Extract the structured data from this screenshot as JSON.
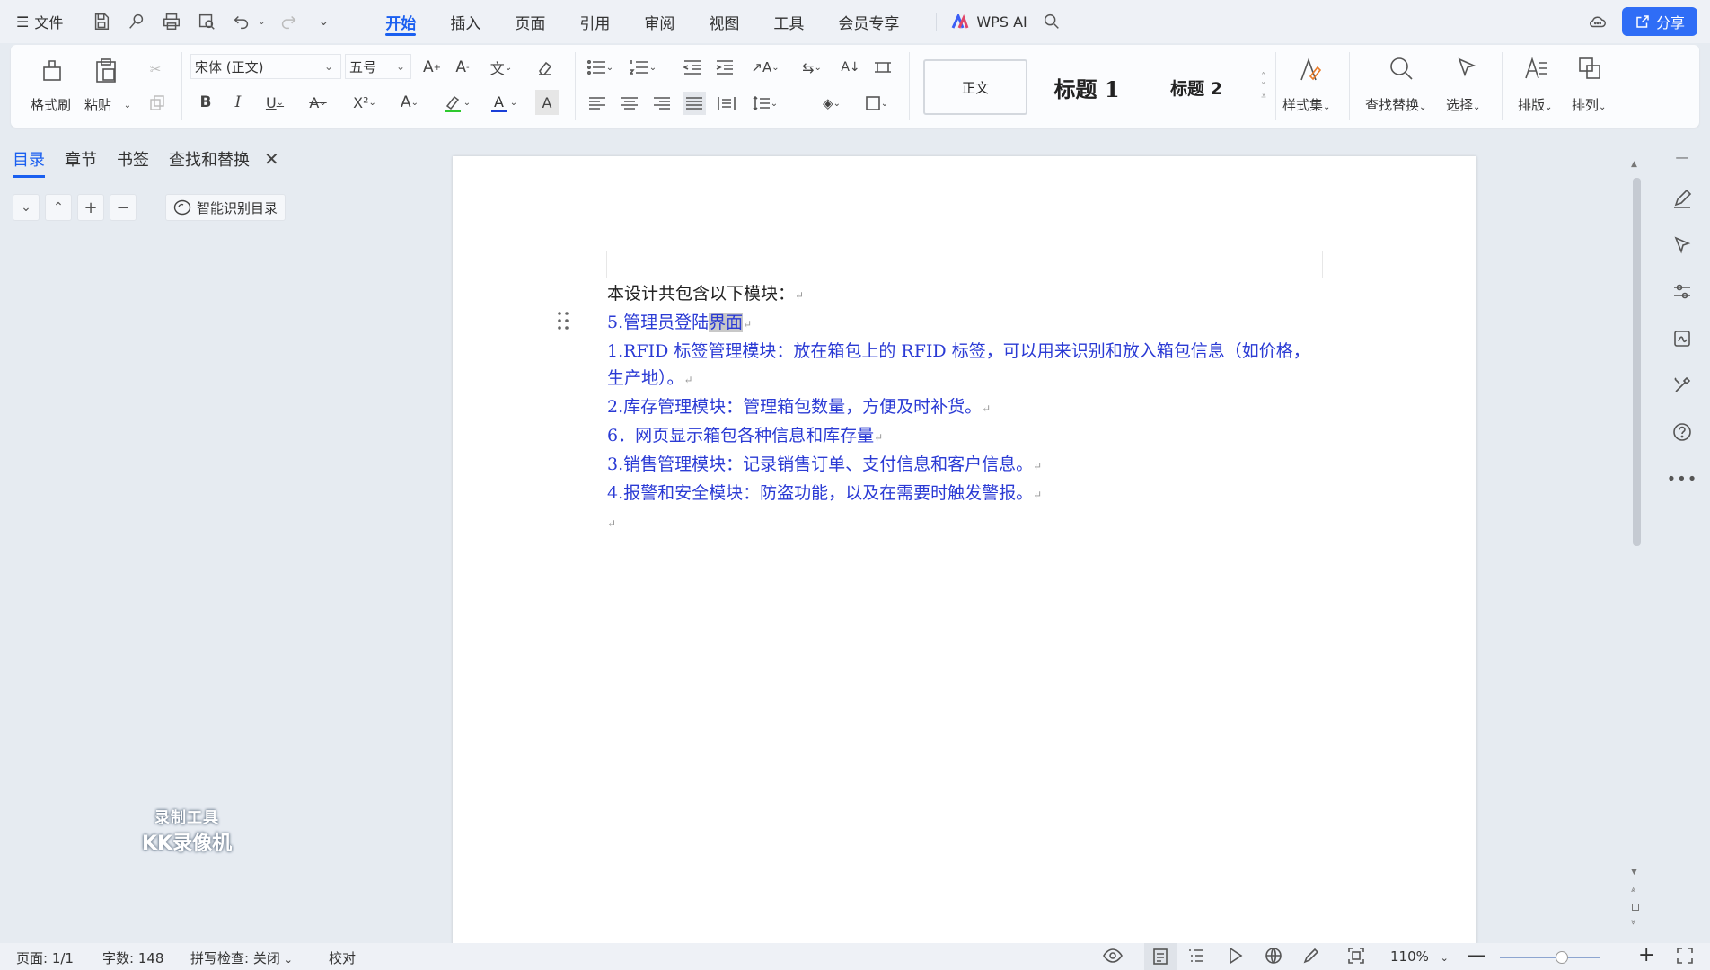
{
  "menubar": {
    "file_label": "文件",
    "tabs": [
      "开始",
      "插入",
      "页面",
      "引用",
      "审阅",
      "视图",
      "工具",
      "会员专享"
    ],
    "active_tab": "开始",
    "ai_label": "WPS AI",
    "share_label": "分享"
  },
  "ribbon": {
    "format_painter": "格式刷",
    "paste": "粘贴",
    "font_name": "宋体 (正文)",
    "font_size": "五号",
    "styles": [
      "正文",
      "标题 1",
      "标题 2"
    ],
    "style_set": "样式集",
    "find_replace": "查找替换",
    "select": "选择",
    "layout": "排版",
    "arrange": "排列"
  },
  "nav": {
    "tabs": [
      "目录",
      "章节",
      "书签",
      "查找和替换"
    ],
    "active_tab": "目录",
    "smart_toc": "智能识别目录"
  },
  "document": {
    "lines": [
      {
        "text": "本设计共包含以下模块：",
        "color": "black"
      },
      {
        "text_pre": "5.管理员登陆",
        "text_hl": "界面",
        "color": "blue"
      },
      {
        "text": "1.RFID 标签管理模块：放在箱包上的 RFID 标签，可以用来识别和放入箱包信息（如价格，",
        "color": "blue"
      },
      {
        "text": "生产地）。",
        "color": "blue"
      },
      {
        "text": "2.库存管理模块：管理箱包数量，方便及时补货。",
        "color": "blue"
      },
      {
        "text": "6．网页显示箱包各种信息和库存量",
        "color": "blue"
      },
      {
        "text": "3.销售管理模块：记录销售订单、支付信息和客户信息。",
        "color": "blue"
      },
      {
        "text": "4.报警和安全模块：防盗功能，以及在需要时触发警报。",
        "color": "blue"
      }
    ]
  },
  "watermark": {
    "line1": "录制工具",
    "line2": "KK录像机"
  },
  "status": {
    "page": "页面: 1/1",
    "words": "字数: 148",
    "spell": "拼写检查: 关闭",
    "proof": "校对",
    "zoom": "110%"
  },
  "colors": {
    "accent": "#1a5ff0",
    "doc_blue": "#2a3ad4",
    "share_bg": "#2f6df6"
  }
}
